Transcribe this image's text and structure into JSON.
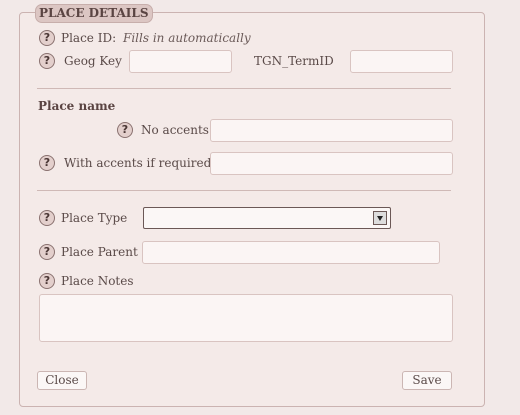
{
  "section_title": "PLACE DETAILS",
  "help_glyph": "?",
  "place_id": {
    "label": "Place ID:",
    "value": "Fills in automatically"
  },
  "geog_key": {
    "label": "Geog Key",
    "value": ""
  },
  "tgn_term_id": {
    "label": "TGN_TermID",
    "value": ""
  },
  "place_name": {
    "heading": "Place name",
    "no_accents": {
      "label": "No accents",
      "value": ""
    },
    "with_accents": {
      "label": "With accents if required",
      "value": ""
    }
  },
  "place_type": {
    "label": "Place Type",
    "selected": ""
  },
  "place_parent": {
    "label": "Place Parent",
    "value": ""
  },
  "place_notes": {
    "label": "Place Notes",
    "value": ""
  },
  "buttons": {
    "close": "Close",
    "save": "Save"
  }
}
